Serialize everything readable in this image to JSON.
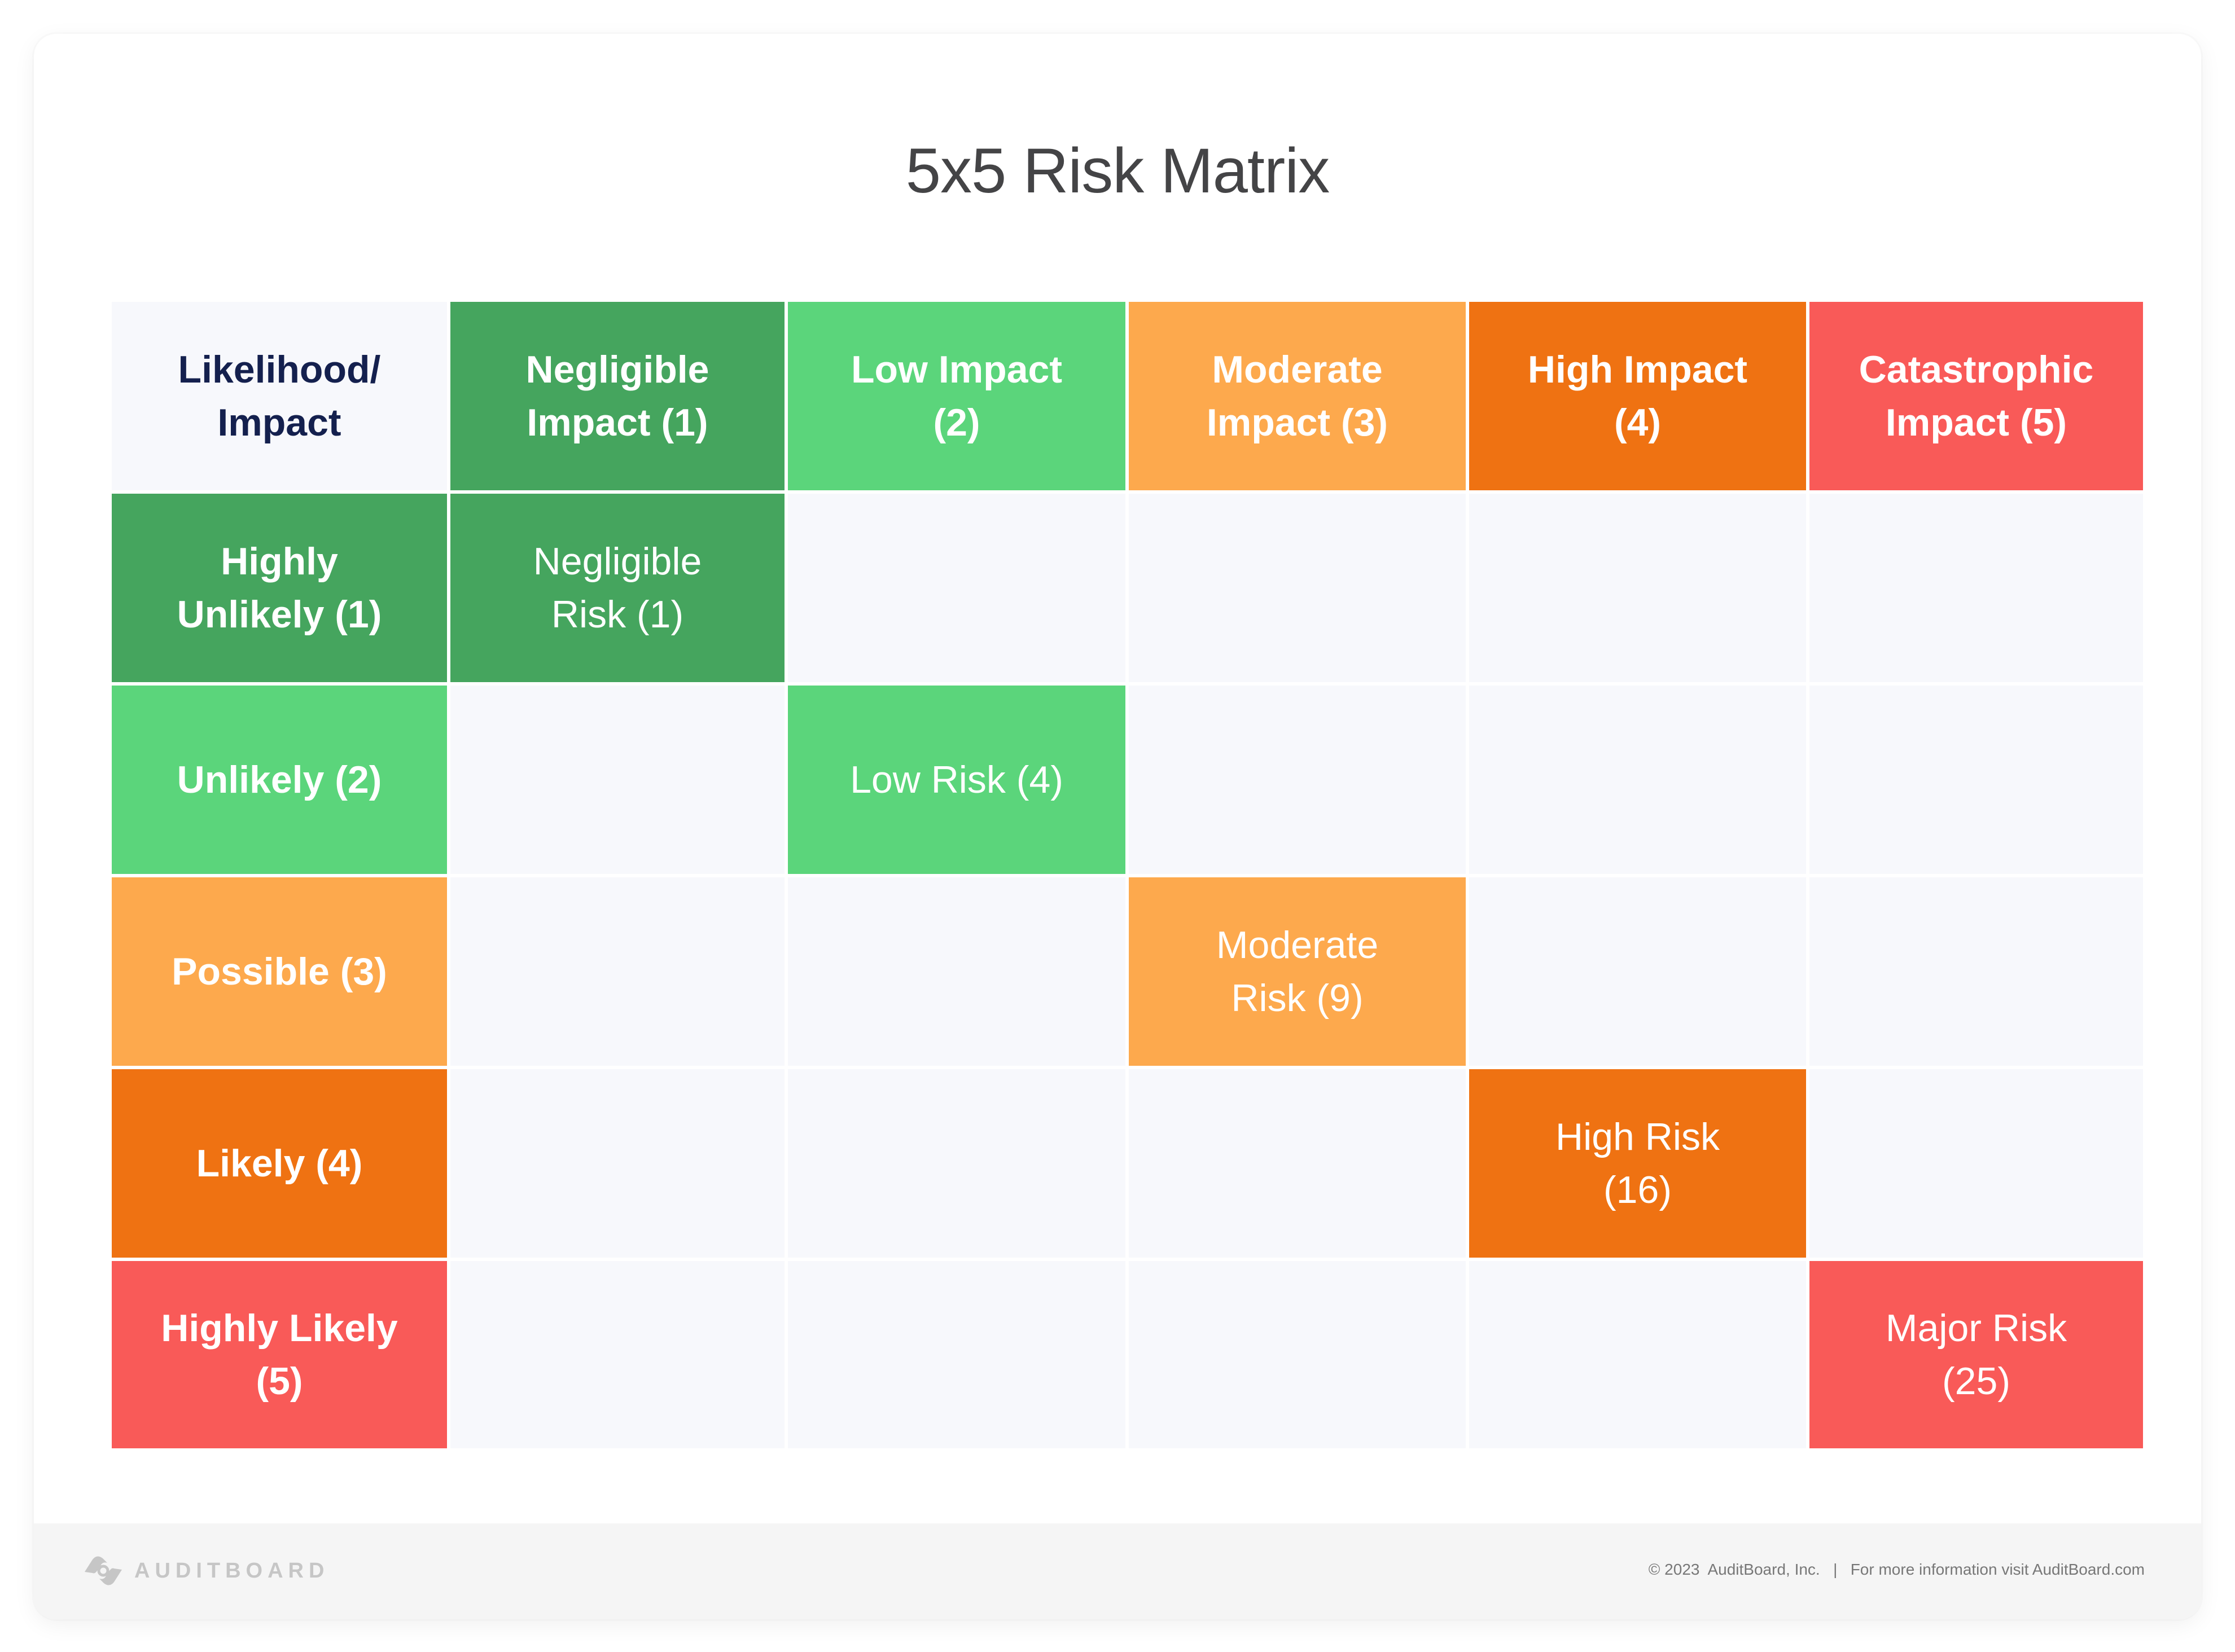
{
  "title": "5x5 Risk Matrix",
  "colors": {
    "level1": "#45a55e",
    "level2": "#5bd57b",
    "level3": "#fda94d",
    "level4": "#ef7212",
    "level5": "#f95a58",
    "empty": "#f7f8fc",
    "corner_text": "#14204e"
  },
  "matrix": {
    "corner_label": "Likelihood/ Impact",
    "impact_headers": [
      {
        "label": "Negligible Impact (1)",
        "level": 1
      },
      {
        "label": "Low Impact (2)",
        "level": 2
      },
      {
        "label": "Moderate Impact (3)",
        "level": 3
      },
      {
        "label": "High Impact (4)",
        "level": 4
      },
      {
        "label": "Catastrophic Impact (5)",
        "level": 5
      }
    ],
    "likelihood_headers": [
      {
        "label": "Highly Unlikely (1)",
        "level": 1
      },
      {
        "label": "Unlikely (2)",
        "level": 2
      },
      {
        "label": "Possible (3)",
        "level": 3
      },
      {
        "label": "Likely (4)",
        "level": 4
      },
      {
        "label": "Highly Likely (5)",
        "level": 5
      }
    ],
    "cells": [
      [
        "Negligible Risk (1)",
        "",
        "",
        "",
        ""
      ],
      [
        "",
        "Low Risk (4)",
        "",
        "",
        ""
      ],
      [
        "",
        "",
        "Moderate Risk (9)",
        "",
        ""
      ],
      [
        "",
        "",
        "",
        "High Risk (16)",
        ""
      ],
      [
        "",
        "",
        "",
        "",
        "Major Risk (25)"
      ]
    ]
  },
  "footer": {
    "logo_text": "AUDITBOARD",
    "copyright": "© 2023  AuditBoard, Inc.",
    "separator": "|",
    "info": "For more information visit AuditBoard.com"
  }
}
